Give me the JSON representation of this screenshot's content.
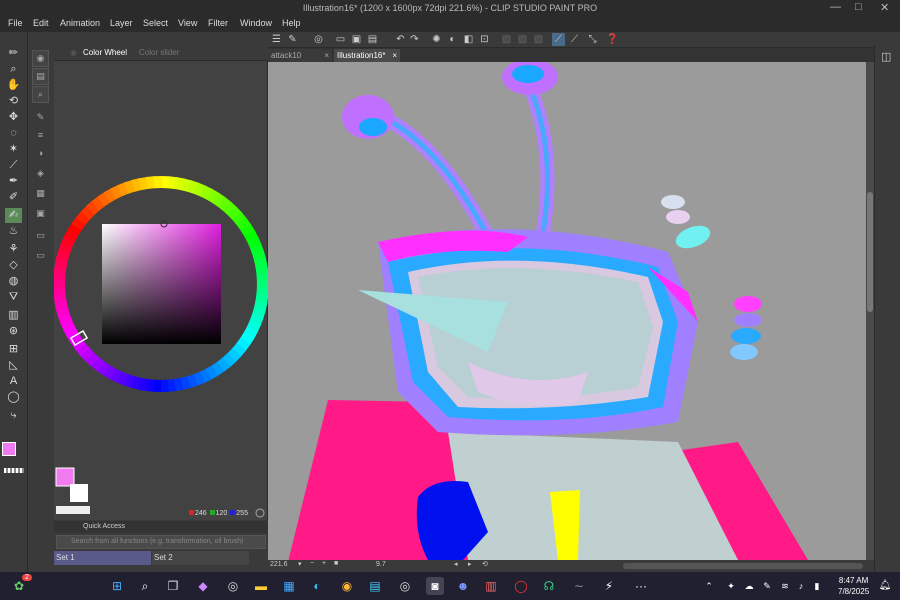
{
  "window": {
    "title": "Illustration16* (1200 x 1600px 72dpi 221.6%) - CLIP STUDIO PAINT PRO",
    "controls": {
      "minimize": "—",
      "maximize": "□",
      "close": "✕"
    }
  },
  "menu": [
    "File",
    "Edit",
    "Animation",
    "Layer",
    "Select",
    "View",
    "Filter",
    "Window",
    "Help"
  ],
  "color_panel": {
    "tab_active": "Color Wheel",
    "tab_inactive": "Color slider",
    "main_color": "#f07af0",
    "sub_color": "#ffffff",
    "readout": {
      "r": "246",
      "g": "120",
      "b": "255"
    }
  },
  "quick_access": {
    "title": "Quick Access",
    "search_placeholder": "Search from all functions (e.g. transformation, oil brush)",
    "sets": [
      "Set 1",
      "Set 2"
    ]
  },
  "tabs": [
    {
      "label": "attack10",
      "close": "×"
    },
    {
      "label": "Illustration16*",
      "close": "×"
    }
  ],
  "status": {
    "zoom": "221.6",
    "angle": "9.7"
  },
  "taskbar": {
    "badge": "2",
    "time": "8:47 AM",
    "date": "7/8/2025",
    "overflow": "···"
  },
  "icons": {
    "tools": [
      "pen",
      "zoom",
      "hand",
      "rotate",
      "move",
      "lasso",
      "wand",
      "eyedropper",
      "pen-nib",
      "pencil",
      "brush",
      "airbrush",
      "decoration",
      "eraser",
      "blend",
      "fill",
      "gradient",
      "figure",
      "frame",
      "balloon",
      "ruler",
      "text",
      "speech",
      "correct"
    ]
  }
}
